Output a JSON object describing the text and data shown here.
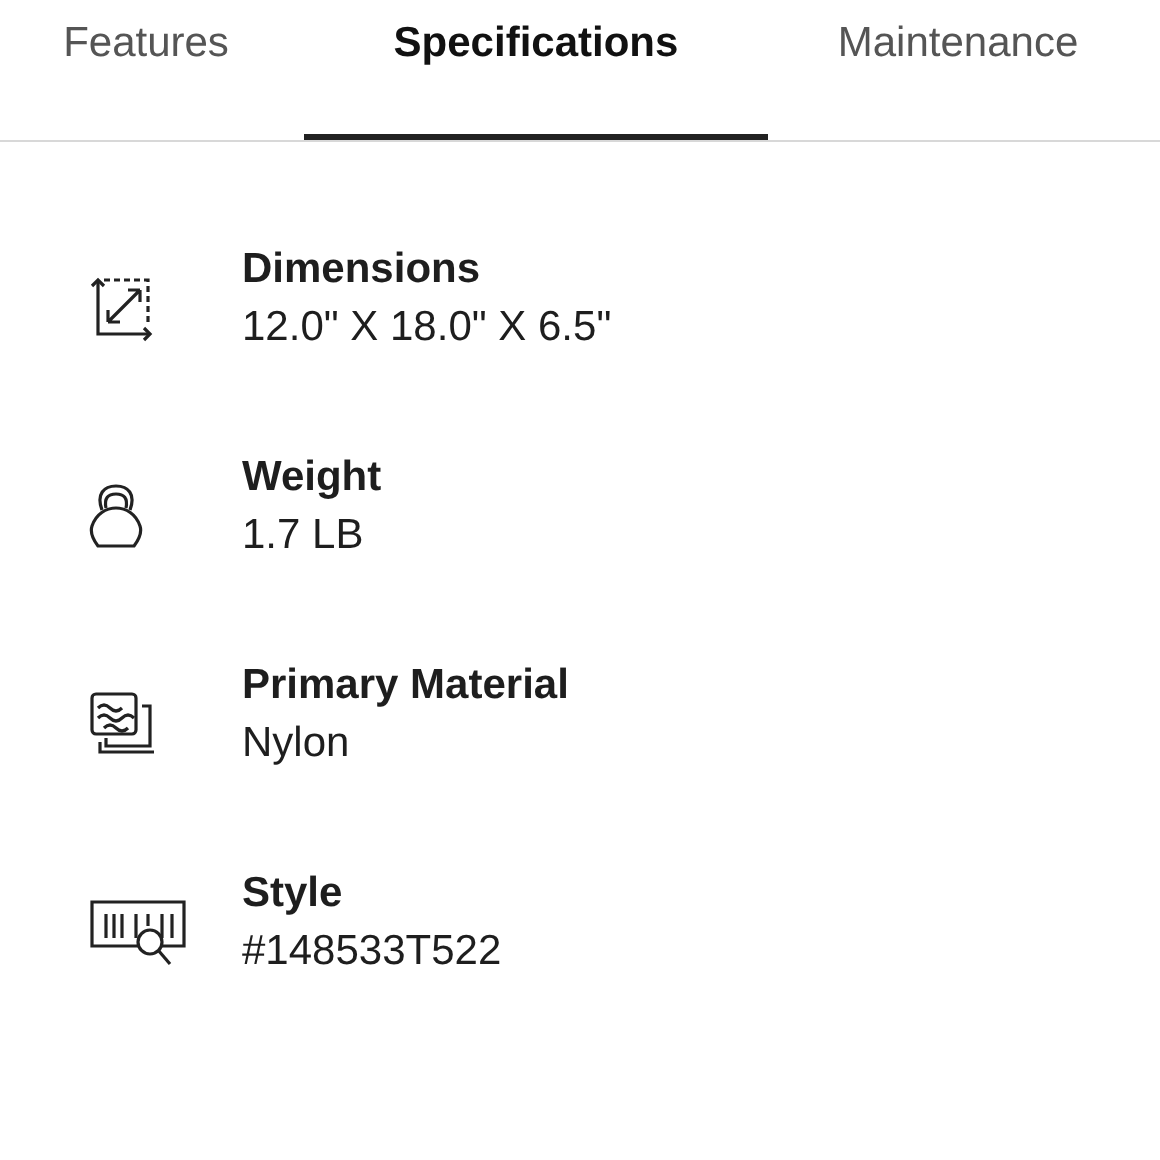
{
  "tabs": [
    {
      "label": "Features",
      "selected": false
    },
    {
      "label": "Specifications",
      "selected": true
    },
    {
      "label": "Maintenance",
      "selected": false
    }
  ],
  "specs": [
    {
      "label": "Dimensions",
      "value": "12.0\" X 18.0\" X 6.5\""
    },
    {
      "label": "Weight",
      "value": "1.7 LB"
    },
    {
      "label": "Primary Material",
      "value": "Nylon"
    },
    {
      "label": "Style",
      "value": "#148533T522"
    }
  ]
}
